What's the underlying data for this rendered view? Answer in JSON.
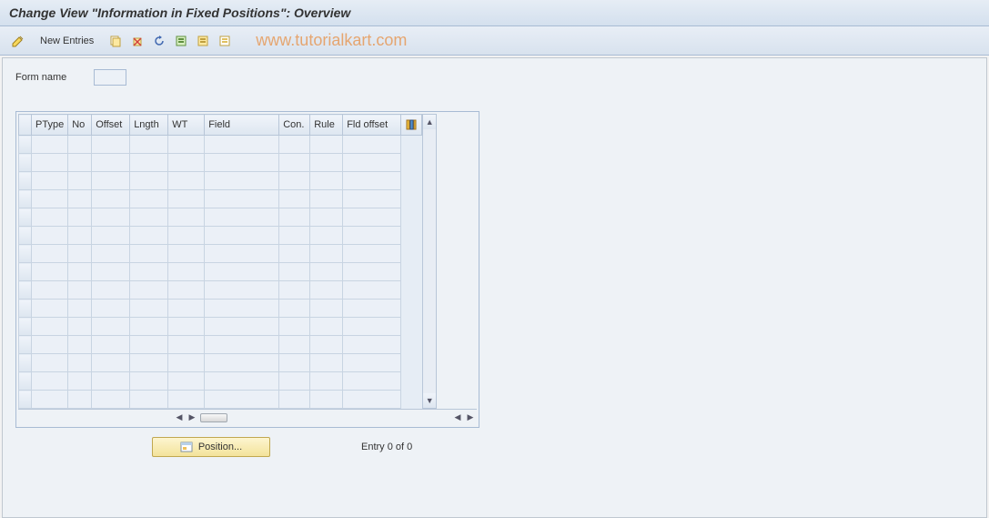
{
  "title": "Change View \"Information in Fixed Positions\": Overview",
  "toolbar": {
    "new_entries": "New Entries"
  },
  "watermark": "www.tutorialkart.com",
  "form": {
    "name_label": "Form name",
    "name_value": ""
  },
  "table": {
    "columns": {
      "ptype": "PType",
      "no": "No",
      "offset": "Offset",
      "length": "Lngth",
      "wt": "WT",
      "field": "Field",
      "con": "Con.",
      "rule": "Rule",
      "fldoffset": "Fld offset"
    },
    "row_count": 15
  },
  "footer": {
    "position_label": "Position...",
    "entry_text": "Entry 0 of 0"
  }
}
